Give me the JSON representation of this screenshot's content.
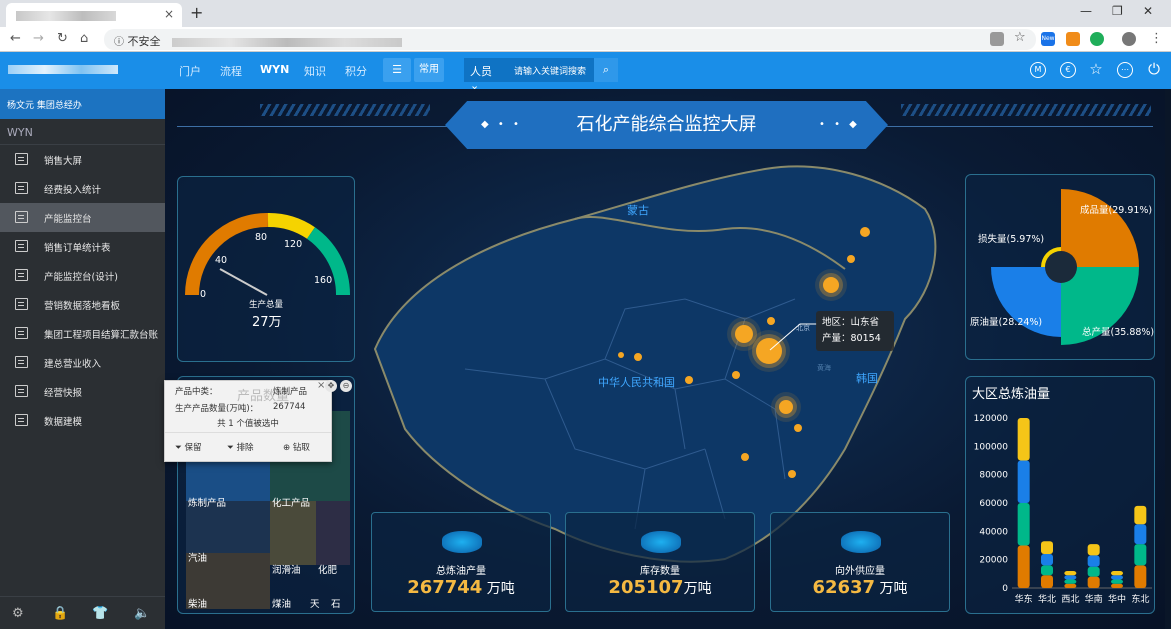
{
  "browser": {
    "tab_close": "×",
    "new_tab": "+",
    "security_label": "不安全",
    "nav": {
      "back": "←",
      "forward": "→",
      "reload": "↻",
      "home": "⌂"
    },
    "window": {
      "minimize": "—",
      "maximize": "❐",
      "close": "✕"
    },
    "ext_new_badge": "New"
  },
  "header": {
    "nav": [
      "门户",
      "流程",
      "WYN",
      "知识",
      "积分"
    ],
    "common_label": "常用",
    "search_scope": "人员",
    "search_placeholder": "请输入关键词搜索",
    "right_icons": [
      "profile-m-icon",
      "skin-icon",
      "favorite-star-icon",
      "more-icon",
      "power-icon"
    ],
    "icon_glyphs": {
      "m": "M",
      "e": "€",
      "star": "☆",
      "more": "⋯",
      "power": "⏻",
      "menu": "☰",
      "search": "⌕"
    }
  },
  "sidebar": {
    "user": "杨文元 集团总经办",
    "workspace": "WYN",
    "items": [
      {
        "label": "销售大屏",
        "active": false
      },
      {
        "label": "经费投入统计",
        "active": false
      },
      {
        "label": "产能监控台",
        "active": true
      },
      {
        "label": "销售订单统计表",
        "active": false
      },
      {
        "label": "产能监控台(设计)",
        "active": false
      },
      {
        "label": "营销数据落地看板",
        "active": false
      },
      {
        "label": "集团工程项目结算汇款台账",
        "active": false
      },
      {
        "label": "建总营业收入",
        "active": false
      },
      {
        "label": "经营快报",
        "active": false
      },
      {
        "label": "数据建模",
        "active": false
      }
    ],
    "footer_icons": [
      "settings-icon",
      "lock-icon",
      "shirt-icon",
      "speaker-icon"
    ],
    "footer_glyphs": [
      "⚙",
      "🔒",
      "👕",
      "🔈"
    ]
  },
  "dashboard": {
    "title": "石化产能综合监控大屏",
    "title_deco": "◆ • •",
    "title_deco_right": "• • ◆",
    "gauge": {
      "label": "生产总量",
      "value_text": "27万",
      "value": 27,
      "min": 0,
      "max": 160,
      "ticks": [
        "0",
        "40",
        "80",
        "120",
        "160"
      ],
      "colors": [
        "#e07b00",
        "#f5d300",
        "#00b88a"
      ]
    },
    "map": {
      "labels": {
        "mongolia": "蒙古",
        "china": "中华人民共和国",
        "korea": "韩国",
        "sea": "黄海",
        "beijing": "北京"
      },
      "tooltip": {
        "region_label": "地区：",
        "region": "山东省",
        "output_label": "产量：",
        "output": "80154"
      }
    },
    "popup": {
      "rows": [
        {
          "key": "产品中类：",
          "value": "炼制产品"
        },
        {
          "key": "生产产品数量(万吨)：",
          "value": "267744"
        }
      ],
      "selected": "共 1 个值被选中",
      "actions": [
        "保留",
        "排除",
        "钻取"
      ],
      "bg_title": "产品数量",
      "close": "×"
    },
    "treemap": {
      "cells": [
        "炼制产品",
        "化工产品",
        "汽油",
        "润滑油",
        "化肥",
        "柴油",
        "煤油",
        "天",
        "石"
      ],
      "colors": [
        "#1a4e86",
        "#1d4a47",
        "#1c3350",
        "#4a4a3a",
        "#2d2d45",
        "#3d3a35"
      ]
    },
    "kpis": [
      {
        "label": "总炼油产量",
        "value": "267744",
        "unit": " 万吨",
        "icon": "chart-growth-icon"
      },
      {
        "label": "库存数量",
        "value": "205107",
        "unit": "万吨",
        "icon": "warehouse-icon"
      },
      {
        "label": "向外供应量",
        "value": "62637",
        "unit": " 万吨",
        "icon": "truck-icon"
      }
    ],
    "pie": {
      "slices": [
        {
          "name": "成品量",
          "pct": 29.91,
          "label": "成品量(29.91%)",
          "color": "#e07b00"
        },
        {
          "name": "总产量",
          "pct": 35.88,
          "label": "总产量(35.88%)",
          "color": "#00b88a"
        },
        {
          "name": "原油量",
          "pct": 28.24,
          "label": "原油量(28.24%)",
          "color": "#1a7fe8"
        },
        {
          "name": "损失量",
          "pct": 5.97,
          "label": "损失量(5.97%)",
          "color": "#f5d300"
        }
      ]
    },
    "bar_title": "大区总炼油量"
  },
  "chart_data": {
    "type": "bar",
    "stacked": true,
    "title": "大区总炼油量",
    "categories": [
      "华东",
      "华北",
      "西北",
      "华南",
      "华中",
      "东北"
    ],
    "series": [
      {
        "color": "#e07b00",
        "values": [
          30000,
          9000,
          3000,
          8000,
          3000,
          16000
        ]
      },
      {
        "color": "#00b88a",
        "values": [
          30000,
          7000,
          3000,
          7000,
          3000,
          15000
        ]
      },
      {
        "color": "#1a7fe8",
        "values": [
          30000,
          8000,
          3000,
          8000,
          3000,
          14000
        ]
      },
      {
        "color": "#f5c518",
        "values": [
          30000,
          9000,
          3000,
          8000,
          3000,
          13000
        ]
      }
    ],
    "yticks": [
      "0",
      "20000",
      "40000",
      "60000",
      "80000",
      "100000",
      "120000"
    ],
    "ylim": [
      0,
      120000
    ]
  },
  "colors": {
    "accent": "#1a8ee8",
    "map_bubble": "#f5a623",
    "kpi_value": "#f5b942"
  }
}
